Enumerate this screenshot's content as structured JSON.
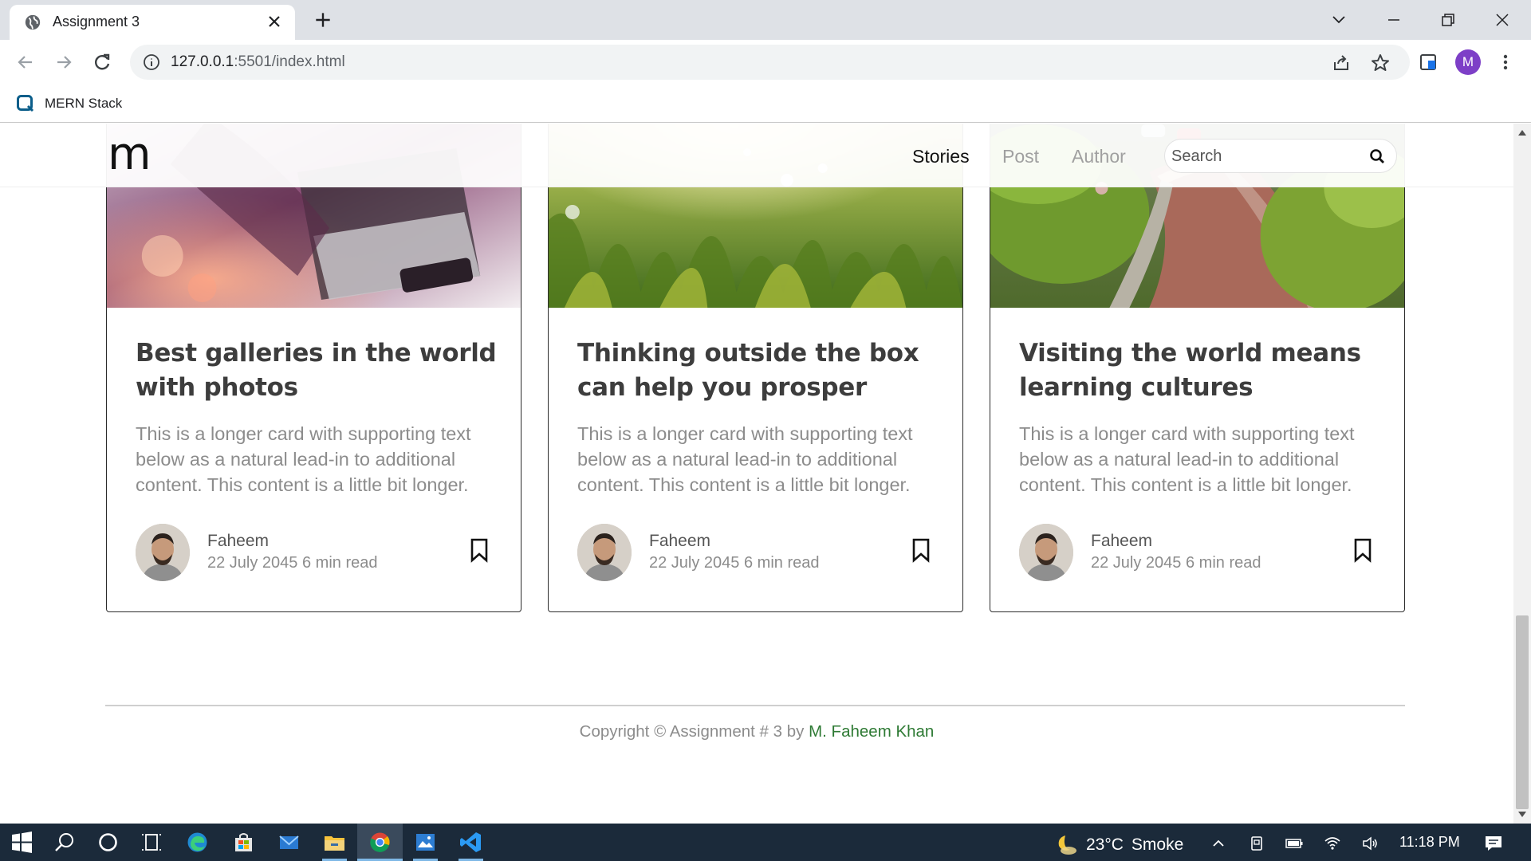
{
  "browser": {
    "tab_title": "Assignment 3",
    "url_host": "127.0.0.1",
    "url_rest": ":5501/index.html",
    "profile_initial": "M",
    "bookmark_label": "MERN Stack"
  },
  "site": {
    "logo": "m",
    "nav": [
      "Stories",
      "Post",
      "Author"
    ],
    "active_nav": "Stories",
    "search_placeholder": "Search"
  },
  "cards": [
    {
      "title": "Best galleries in the world with photos",
      "text": "This is a longer card with supporting text below as a natural lead-in to additional content. This content is a little bit longer.",
      "author": "Faheem",
      "meta": "22 July 2045 6 min read"
    },
    {
      "title": "Thinking outside the box can help you prosper",
      "text": "This is a longer card with supporting text below as a natural lead-in to additional content. This content is a little bit longer.",
      "author": "Faheem",
      "meta": "22 July 2045 6 min read"
    },
    {
      "title": "Visiting the world means learning cultures",
      "text": "This is a longer card with supporting text below as a natural lead-in to additional content. This content is a little bit longer.",
      "author": "Faheem",
      "meta": "22 July 2045 6 min read"
    }
  ],
  "footer": {
    "copyright_prefix": "Copyright © Assignment # 3 by",
    "owner": "M. Faheem Khan"
  },
  "taskbar": {
    "temperature": "23°C",
    "weather": "Smoke",
    "time": "11:18 PM"
  },
  "colors": {
    "footer_owner": "#2e7a34",
    "taskbar_bg": "#1b2a3a",
    "profile_avatar": "#7d3fc7"
  }
}
